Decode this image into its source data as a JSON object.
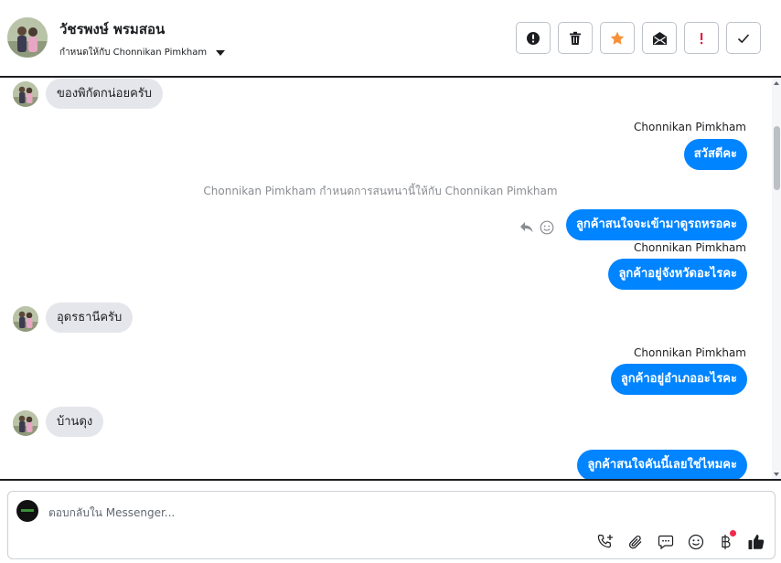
{
  "header": {
    "title": "วัชรพงษ์ พรมสอน",
    "assigned_to": "กำหนดให้กับ Chonnikan Pimkham",
    "toolbar": [
      {
        "name": "report-button",
        "icon": "alert-circle-icon"
      },
      {
        "name": "delete-button",
        "icon": "trash-icon"
      },
      {
        "name": "star-button",
        "icon": "star-icon"
      },
      {
        "name": "mark-unread-button",
        "icon": "envelope-icon"
      },
      {
        "name": "priority-button",
        "icon": "exclamation-icon"
      },
      {
        "name": "mark-done-button",
        "icon": "check-icon"
      }
    ]
  },
  "thread": {
    "messages": [
      {
        "side": "in",
        "text": "ของพิกัดกน่อยครับ"
      },
      {
        "side": "out",
        "sender": "Chonnikan Pimkham",
        "text": "สวัสดีคะ"
      },
      {
        "side": "system",
        "text": "Chonnikan Pimkham กำหนดการสนทนานี้ให้กับ Chonnikan Pimkham"
      },
      {
        "side": "out",
        "text": "ลูกค้าสนใจจะเข้ามาดูรถหรอคะ"
      },
      {
        "side": "out",
        "sender": "Chonnikan Pimkham",
        "text": "ลูกค้าอยู่จังหวัดอะไรคะ"
      },
      {
        "side": "in",
        "text": "อุดรธานีครับ"
      },
      {
        "side": "out",
        "sender": "Chonnikan Pimkham",
        "text": "ลูกค้าอยู่อำเภออะไรคะ"
      },
      {
        "side": "in",
        "text": "บ้านดุง"
      },
      {
        "side": "out",
        "text": "ลูกค้าสนใจคันนี้เลยใช่ไหมคะ"
      }
    ]
  },
  "composer": {
    "placeholder": "ตอบกลับใน Messenger..."
  },
  "colors": {
    "outgoing_bubble": "#0084ff",
    "incoming_bubble": "#e4e6eb",
    "star": "#f7923a",
    "priority": "#e41e3f",
    "notification_dot": "#f02849"
  }
}
